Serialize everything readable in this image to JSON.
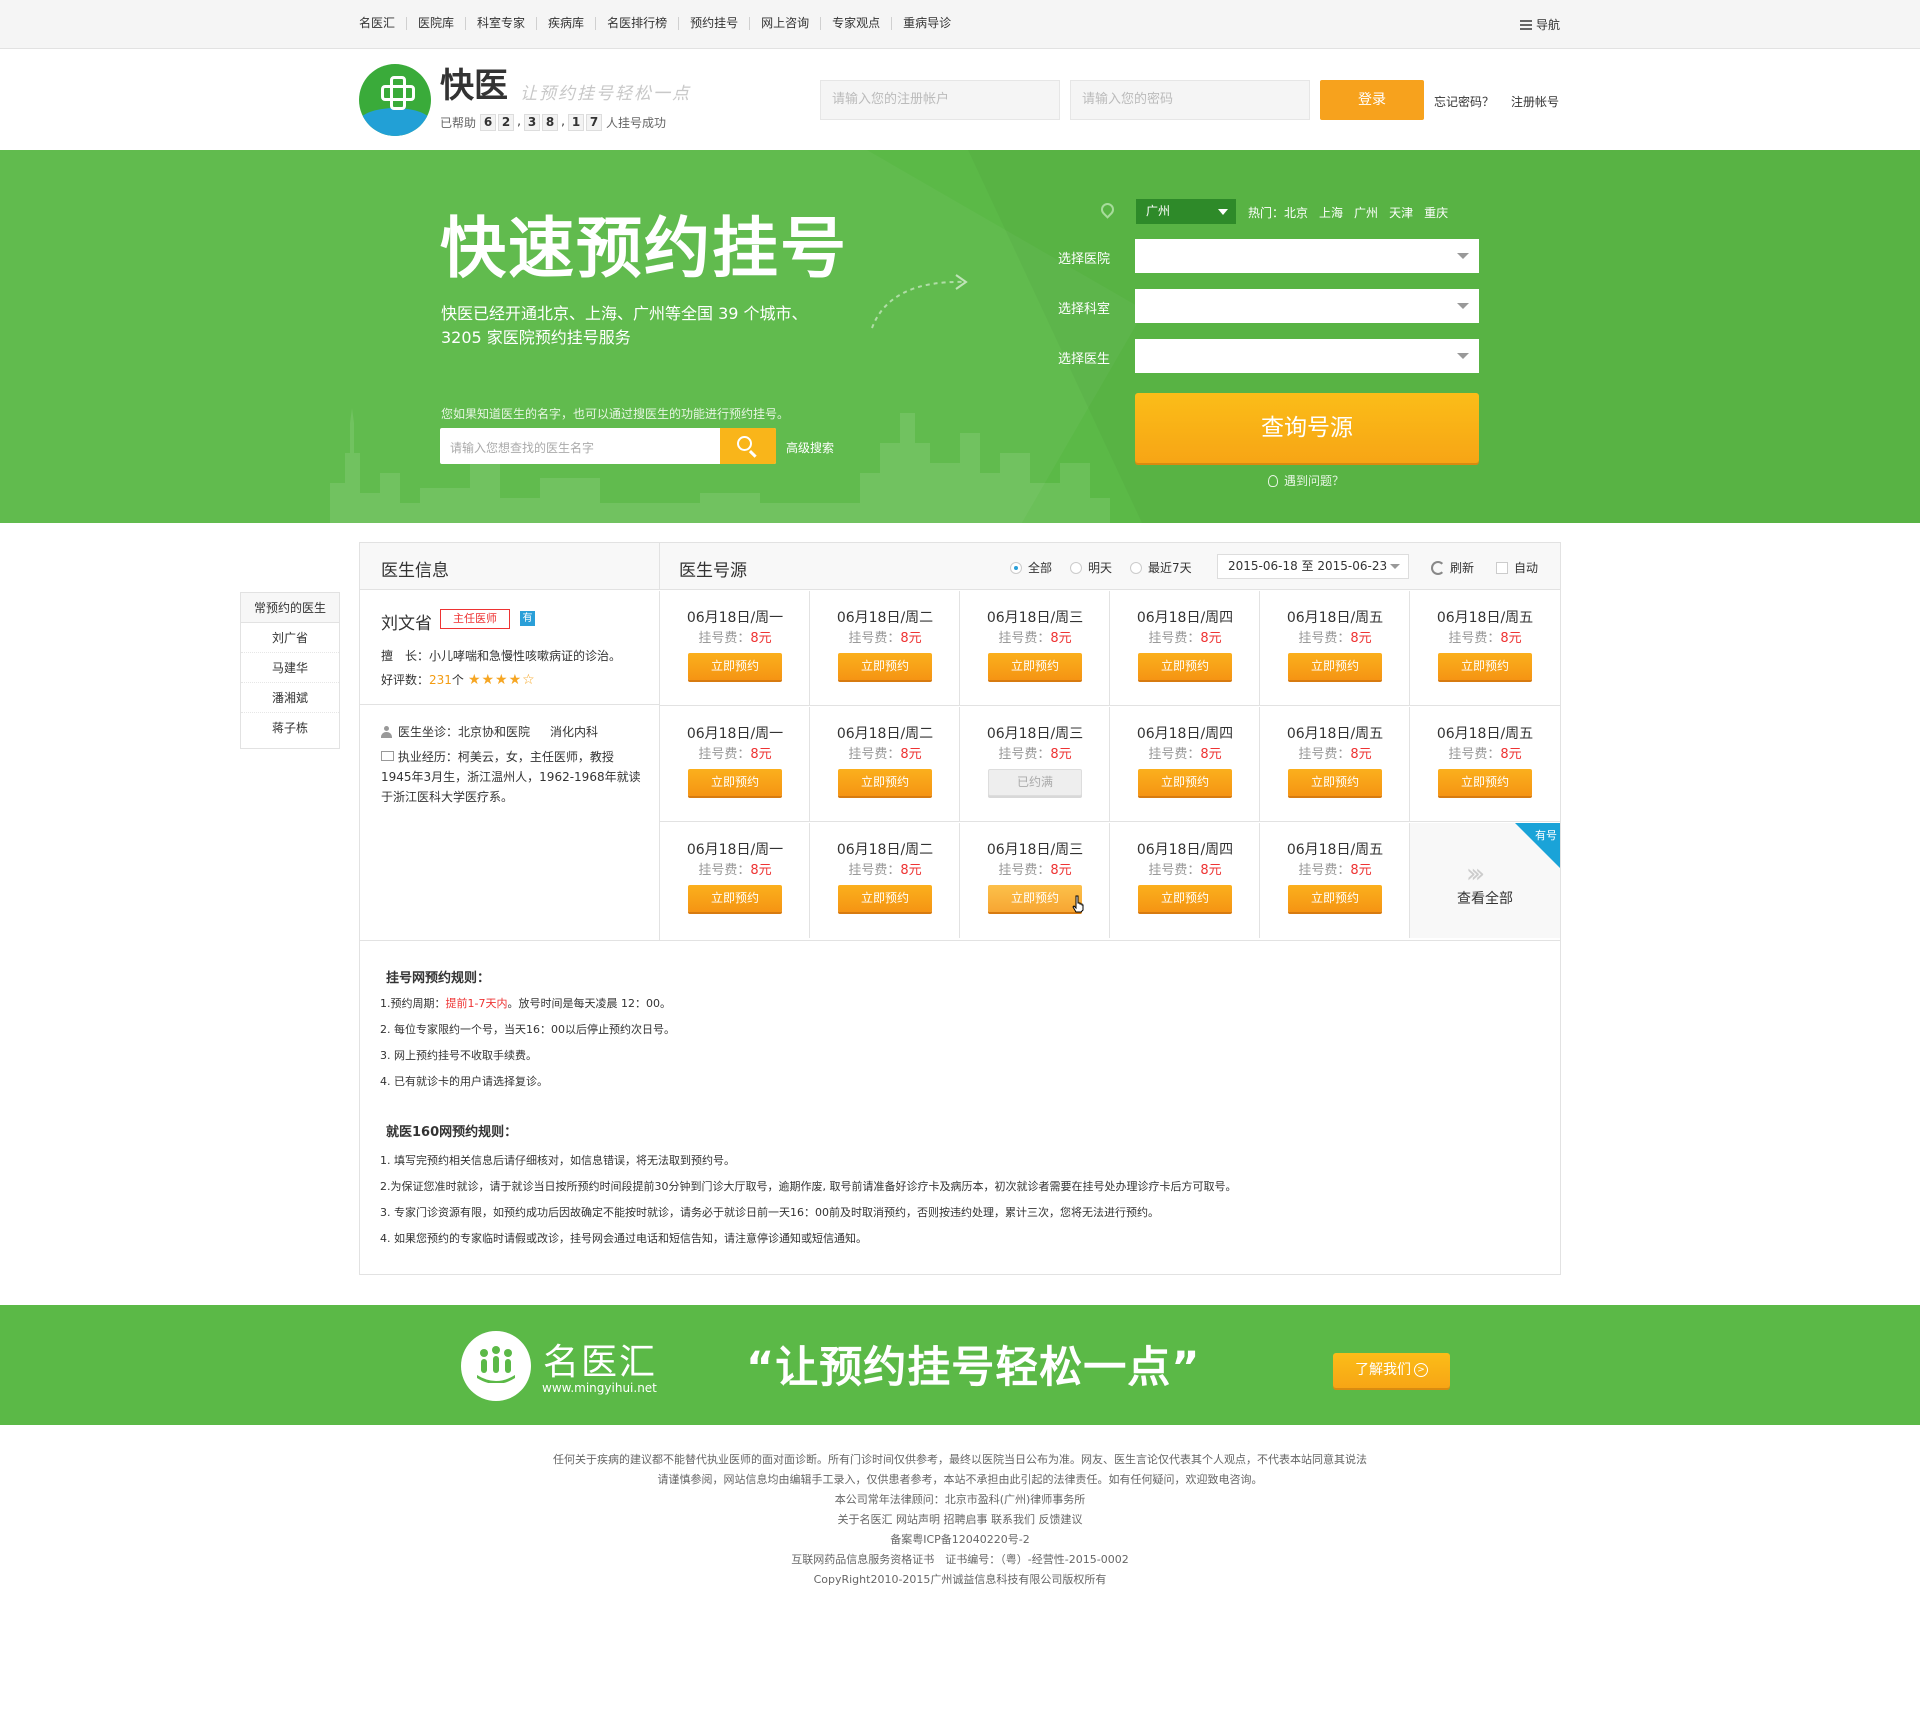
{
  "topnav": {
    "links": [
      "名医汇",
      "医院库",
      "科室专家",
      "疾病库",
      "名医排行榜",
      "预约挂号",
      "网上咨询",
      "专家观点",
      "重病导诊"
    ],
    "guide_label": "导航"
  },
  "header": {
    "brand": "快医",
    "slogan": "让预约挂号轻松一点",
    "helped_prefix": "已帮助",
    "helped_digits": [
      "6",
      "2",
      "3",
      "8",
      "1",
      "7"
    ],
    "helped_suffix": "人挂号成功",
    "username_placeholder": "请输入您的注册帐户",
    "password_placeholder": "请输入您的密码",
    "login_label": "登录",
    "forgot_label": "忘记密码？",
    "register_label": "注册帐号"
  },
  "hero": {
    "title": "快速预约挂号",
    "desc_line1": "快医已经开通北京、上海、广州等全国 39 个城市、",
    "desc_line2": "3205 家医院预约挂号服务",
    "hint": "您如果知道医生的名字，也可以通过搜医生的功能进行预约挂号。",
    "search_placeholder": "请输入您想查找的医生名字",
    "advanced_search": "高级搜索",
    "city": "广州",
    "hot_label": "热门：",
    "hot_cities": [
      "北京",
      "上海",
      "广州",
      "天津",
      "重庆"
    ],
    "hospital_label": "选择医院",
    "department_label": "选择科室",
    "doctor_label": "选择医生",
    "query_button": "查询号源",
    "help_link": "遇到问题？"
  },
  "sidebar": {
    "title": "常预约的医生",
    "items": [
      "刘广省",
      "马建华",
      "潘湘斌",
      "蒋子栋"
    ]
  },
  "panel": {
    "left_title": "医生信息",
    "right_title": "医生号源",
    "filters": [
      "全部",
      "明天",
      "最近7天"
    ],
    "date_range": "2015-06-18 至 2015-06-23",
    "refresh": "刷新",
    "auto": "自动"
  },
  "doctor": {
    "name": "刘文省",
    "title_tag": "主任医师",
    "yes_tag": "有",
    "specialty_label": "擅　长：",
    "specialty": "小儿哮喘和急慢性咳嗽病证的诊治。",
    "rating_label": "好评数：",
    "rating_count": "231",
    "rating_unit": "个",
    "stars": "★★★★☆",
    "star_rating": 4,
    "hospital_label": "医生坐诊：",
    "hospital": "北京协和医院",
    "department": "消化内科",
    "experience_label": "执业经历：",
    "experience": "柯美云，女，主任医师，教授 1945年3月生，浙江温州人，1962-1968年就读于浙江医科大学医疗系。"
  },
  "schedule": {
    "fee_label": "挂号费：",
    "rows": [
      [
        {
          "date": "06月18日/周一",
          "fee": "8元",
          "button": "立即预约",
          "state": "normal"
        },
        {
          "date": "06月18日/周二",
          "fee": "8元",
          "button": "立即预约",
          "state": "normal"
        },
        {
          "date": "06月18日/周三",
          "fee": "8元",
          "button": "立即预约",
          "state": "normal"
        },
        {
          "date": "06月18日/周四",
          "fee": "8元",
          "button": "立即预约",
          "state": "normal"
        },
        {
          "date": "06月18日/周五",
          "fee": "8元",
          "button": "立即预约",
          "state": "normal"
        },
        {
          "date": "06月18日/周五",
          "fee": "8元",
          "button": "立即预约",
          "state": "normal"
        }
      ],
      [
        {
          "date": "06月18日/周一",
          "fee": "8元",
          "button": "立即预约",
          "state": "normal"
        },
        {
          "date": "06月18日/周二",
          "fee": "8元",
          "button": "立即预约",
          "state": "normal"
        },
        {
          "date": "06月18日/周三",
          "fee": "8元",
          "button": "已约满",
          "state": "full"
        },
        {
          "date": "06月18日/周四",
          "fee": "8元",
          "button": "立即预约",
          "state": "normal"
        },
        {
          "date": "06月18日/周五",
          "fee": "8元",
          "button": "立即预约",
          "state": "normal"
        },
        {
          "date": "06月18日/周五",
          "fee": "8元",
          "button": "立即预约",
          "state": "normal"
        }
      ],
      [
        {
          "date": "06月18日/周一",
          "fee": "8元",
          "button": "立即预约",
          "state": "normal"
        },
        {
          "date": "06月18日/周二",
          "fee": "8元",
          "button": "立即预约",
          "state": "normal"
        },
        {
          "date": "06月18日/周三",
          "fee": "8元",
          "button": "立即预约",
          "state": "hover"
        },
        {
          "date": "06月18日/周四",
          "fee": "8元",
          "button": "立即预约",
          "state": "normal"
        },
        {
          "date": "06月18日/周五",
          "fee": "8元",
          "button": "立即预约",
          "state": "normal"
        }
      ]
    ],
    "view_all": "查看全部",
    "corner_tag": "有号"
  },
  "rules": {
    "title1": "挂号网预约规则：",
    "list1_item1_prefix": "1.预约周期：",
    "list1_item1_red": "提前1-7天内",
    "list1_item1_suffix": "。放号时间是每天凌晨 12：00。",
    "list1": [
      "2. 每位专家限约一个号，当天16：00以后停止预约次日号。",
      "3. 网上预约挂号不收取手续费。",
      "4. 已有就诊卡的用户请选择复诊。"
    ],
    "title2": "就医160网预约规则：",
    "list2": [
      "1. 填写完预约相关信息后请仔细核对，如信息错误，将无法取到预约号。",
      "2.为保证您准时就诊，请于就诊当日按所预约时间段提前30分钟到门诊大厅取号，逾期作废, 取号前请准备好诊疗卡及病历本，初次就诊者需要在挂号处办理诊疗卡后方可取号。",
      "3. 专家门诊资源有限，如预约成功后因故确定不能按时就诊，请务必于就诊日前一天16：00前及时取消预约，否则按违约处理，累计三次，您将无法进行预约。",
      "4. 如果您预约的专家临时请假或改诊，挂号网会通过电话和短信告知，请注意停诊通知或短信通知。"
    ]
  },
  "banner": {
    "name": "名医汇",
    "url": "www.mingyihui.net",
    "slogan": "“让预约挂号轻松一点”",
    "button": "了解我们"
  },
  "footer": {
    "lines": [
      "任何关于疾病的建议都不能替代执业医师的面对面诊断。所有门诊时间仅供参考，最终以医院当日公布为准。网友、医生言论仅代表其个人观点，不代表本站同意其说法",
      "请谨慎参阅，网站信息均由编辑手工录入，仅供患者参考，本站不承担由此引起的法律责任。如有任何疑问，欢迎致电咨询。",
      "本公司常年法律顾问：北京市盈科(广州)律师事务所",
      "关于名医汇  网站声明  招聘启事  联系我们  反馈建议",
      "备案粤ICP备12040220号-2",
      "互联网药品信息服务资格证书　证书编号：（粤）-经营性-2015-0002",
      "CopyRight2010-2015广州诚益信息科技有限公司版权所有"
    ]
  },
  "colors": {
    "green": "#5bb947",
    "orange": "#f7a21d",
    "blue": "#1aa3d8",
    "red": "#e33333"
  }
}
